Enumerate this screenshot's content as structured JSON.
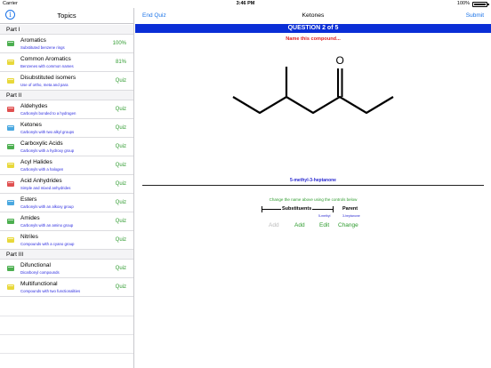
{
  "status_bar": {
    "carrier": "Carrier",
    "time": "3:46 PM",
    "battery": "100%"
  },
  "sidebar": {
    "title": "Topics",
    "sections": [
      {
        "label": "Part I",
        "items": [
          {
            "title": "Aromatics",
            "subtitle": "Substituted benzene rings",
            "status": "100%",
            "icon_color": "#4caf50"
          },
          {
            "title": "Common Aromatics",
            "subtitle": "Benzenes with common names",
            "status": "81%",
            "icon_color": "#e8d83a"
          },
          {
            "title": "Disubstituted isomers",
            "subtitle": "Use of ortho, meta and para",
            "status": "Quiz",
            "icon_color": "#e8d83a"
          }
        ]
      },
      {
        "label": "Part II",
        "items": [
          {
            "title": "Aldehydes",
            "subtitle": "Carbonyls bonded to a hydrogen",
            "status": "Quiz",
            "icon_color": "#e05050"
          },
          {
            "title": "Ketones",
            "subtitle": "Carbonyls with two alkyl groups",
            "status": "Quiz",
            "icon_color": "#4aa8e0"
          },
          {
            "title": "Carboxylic Acids",
            "subtitle": "Carbonyls with a hydroxy group",
            "status": "Quiz",
            "icon_color": "#4caf50"
          },
          {
            "title": "Acyl Halides",
            "subtitle": "Carbonyls with a halogen",
            "status": "Quiz",
            "icon_color": "#e8d83a"
          },
          {
            "title": "Acid Anhydrides",
            "subtitle": "Simple and mixed anhydrides",
            "status": "Quiz",
            "icon_color": "#e05050"
          },
          {
            "title": "Esters",
            "subtitle": "Carbonyls with an alkoxy group",
            "status": "Quiz",
            "icon_color": "#4aa8e0"
          },
          {
            "title": "Amides",
            "subtitle": "Carbonyls with an amino group",
            "status": "Quiz",
            "icon_color": "#4caf50"
          },
          {
            "title": "Nitriles",
            "subtitle": "Compounds with a cyano group",
            "status": "Quiz",
            "icon_color": "#e8d83a"
          }
        ]
      },
      {
        "label": "Part III",
        "items": [
          {
            "title": "Difunctional",
            "subtitle": "Dicarbonyl compounds",
            "status": "Quiz",
            "icon_color": "#4caf50"
          },
          {
            "title": "Multifunctional",
            "subtitle": "Compounds with two functionalities",
            "status": "Quiz",
            "icon_color": "#e8d83a"
          }
        ]
      }
    ]
  },
  "nav": {
    "left": "End Quiz",
    "title": "Ketones",
    "right": "Submit"
  },
  "quiz": {
    "banner": "QUESTION 2 of 5",
    "prompt": "Name this compound...",
    "oxygen_label": "O",
    "answer_name": "5-methyl-3-heptanone",
    "instruction": "Change the name above using the controls below",
    "substituents_label": "Substituents",
    "parent_label": "Parent",
    "substituent_value": "5-methyl",
    "parent_value": "3-heptanone",
    "actions": [
      "Add",
      "Add",
      "Edit",
      "Change"
    ]
  },
  "colors": {
    "accent": "#1a73e8",
    "banner": "#0a2ed6",
    "prompt": "#e02020",
    "quiz_green": "#2e9b2e",
    "answer_blue": "#2a2ad0"
  }
}
